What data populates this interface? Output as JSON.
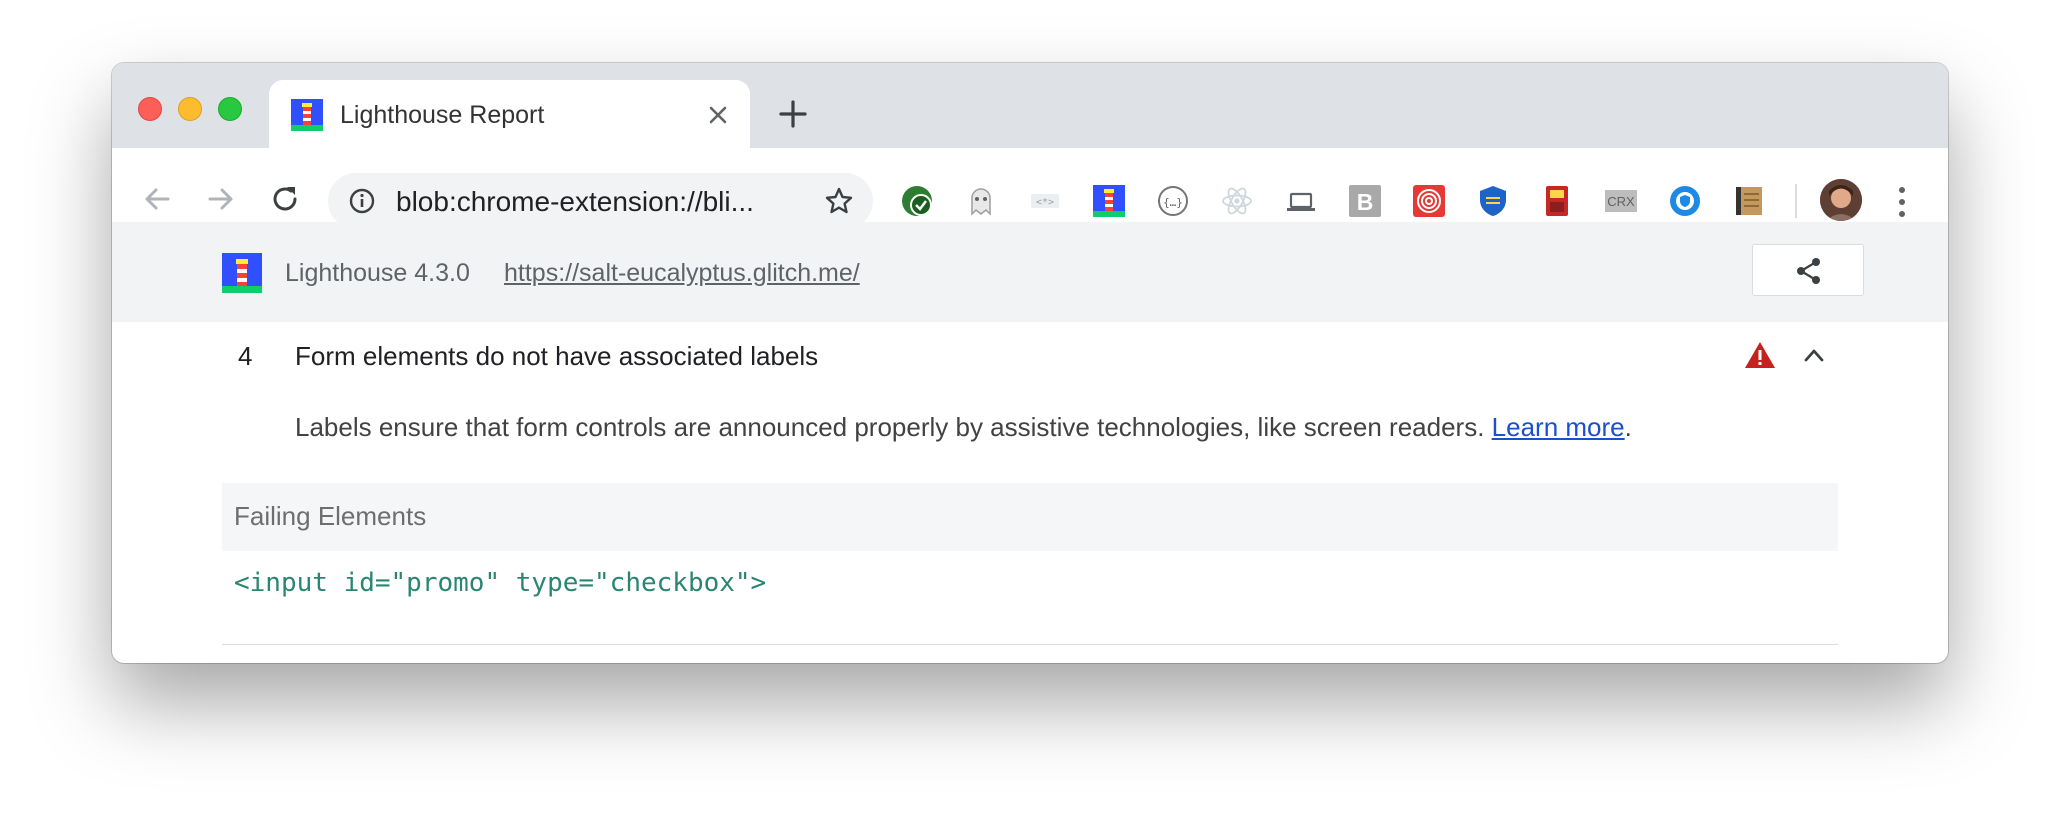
{
  "tab": {
    "title": "Lighthouse Report"
  },
  "omnibox": {
    "url": "blob:chrome-extension://bli..."
  },
  "extensions": [
    "check-circle-icon",
    "ghost-icon",
    "dev-mode-icon",
    "lighthouse-icon",
    "json-icon",
    "react-icon",
    "laptop-icon",
    "bootstrap-icon",
    "spiral-icon",
    "shield-icon",
    "sd-card-icon",
    "crx-icon",
    "privacy-badge-icon",
    "notebook-icon"
  ],
  "crx_label": "CRX",
  "bootstrap_label": "B",
  "lighthouse": {
    "version": "Lighthouse 4.3.0",
    "url": "https://salt-eucalyptus.glitch.me/"
  },
  "audit": {
    "number": "4",
    "title": "Form elements do not have associated labels",
    "description": "Labels ensure that form controls are announced properly by assistive technologies, like screen readers.",
    "learn_more": "Learn more",
    "period": ".",
    "failing_label": "Failing Elements",
    "code": "<input id=\"promo\" type=\"checkbox\">"
  },
  "colors": {
    "warning": "#c5221f",
    "link": "#1a4fcf",
    "code": "#2b8573"
  }
}
